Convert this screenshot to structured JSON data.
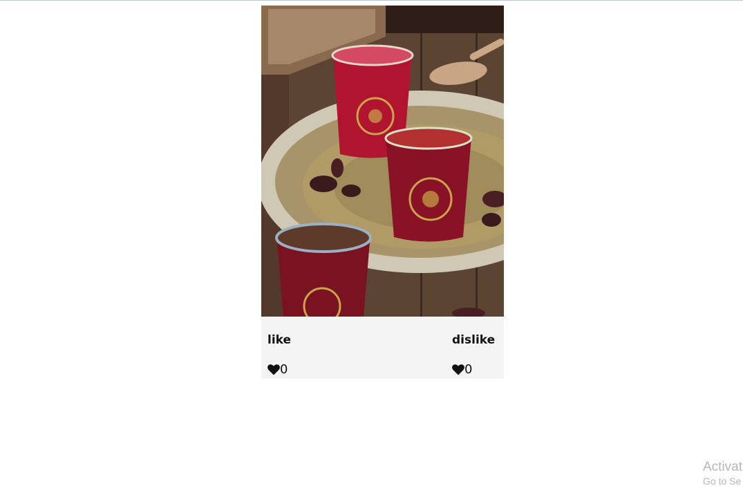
{
  "card": {
    "image_alt": "Hibiscus drink in glasses on a tray",
    "like": {
      "label": "like",
      "count": "0",
      "icon": "heart-icon"
    },
    "dislike": {
      "label": "dislike",
      "count": "0",
      "icon": "heart-icon"
    }
  },
  "watermark": {
    "title": "Activat",
    "subtitle": "Go to Se"
  },
  "colors": {
    "footer_bg": "#f4f4f4",
    "text": "#111111",
    "watermark": "#b6b6b6"
  }
}
